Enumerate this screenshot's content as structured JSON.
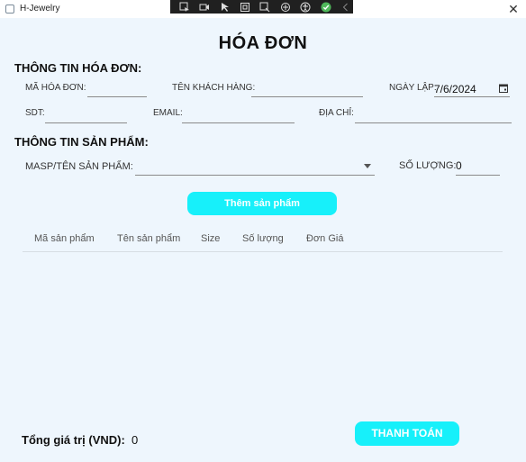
{
  "window": {
    "title": "H-Jewelry",
    "close_glyph": "✕"
  },
  "devtools": {
    "icons": [
      "select-element-icon",
      "video-icon",
      "pointer-icon",
      "square-icon",
      "inspect-icon",
      "layout-icon",
      "accessibility-icon",
      "check-icon",
      "chevron-left-icon"
    ]
  },
  "page": {
    "title": "HÓA ĐƠN"
  },
  "invoice_info": {
    "section_title": "THÔNG TIN HÓA ĐƠN:",
    "invoice_id_label": "MÃ HÓA ĐƠN:",
    "invoice_id_value": "",
    "customer_name_label": "TÊN KHÁCH HÀNG:",
    "customer_name_value": "",
    "date_label": "NGÀY LẬP:",
    "date_value": "7/6/2024",
    "phone_label": "SDT:",
    "phone_value": "",
    "email_label": "EMAIL:",
    "email_value": "",
    "address_label": "ĐỊA CHỈ:",
    "address_value": ""
  },
  "product_info": {
    "section_title": "THÔNG TIN SẢN PHẨM:",
    "product_label": "MASP/TÊN SẢN PHẨM:",
    "product_value": "",
    "quantity_label": "SỐ LƯỢNG:",
    "quantity_value": "0",
    "add_button": "Thêm sản phẩm"
  },
  "table": {
    "columns": [
      "Mã sản phẩm",
      "Tên sản phẩm",
      "Size",
      "Số lượng",
      "Đơn Giá"
    ],
    "rows": []
  },
  "footer": {
    "total_label": "Tổng giá trị (VND):",
    "total_value": "0",
    "pay_button": "THANH TOÁN"
  },
  "colors": {
    "accent": "#17f0fa",
    "background": "#eef6fd"
  }
}
